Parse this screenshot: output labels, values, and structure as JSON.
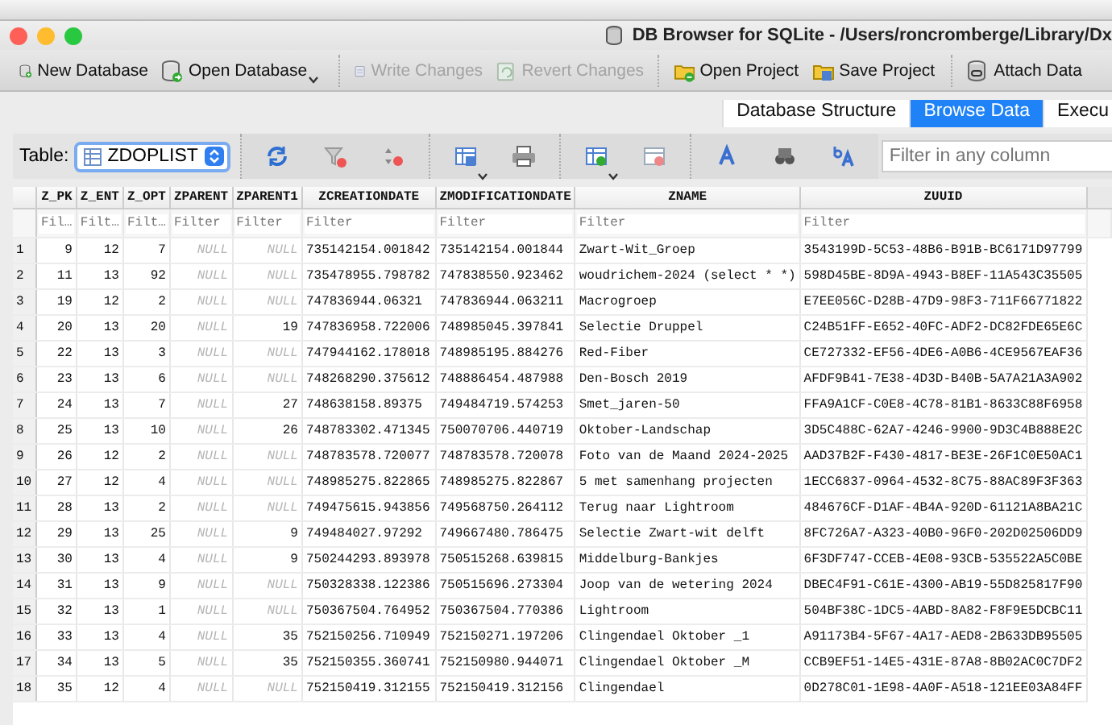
{
  "title_bar": {
    "title": "DB Browser for SQLite - /Users/roncromberge/Library/Dx"
  },
  "toolbar": {
    "buttons": [
      {
        "label": "New Database",
        "disabled": false
      },
      {
        "label": "Open Database",
        "disabled": false
      },
      {
        "label": "Write Changes",
        "disabled": true
      },
      {
        "label": "Revert Changes",
        "disabled": true
      },
      {
        "label": "Open Project",
        "disabled": false
      },
      {
        "label": "Save Project",
        "disabled": false
      },
      {
        "label": "Attach Data",
        "disabled": false
      }
    ]
  },
  "tabs": [
    {
      "label": "Database Structure",
      "selected": false
    },
    {
      "label": "Browse Data",
      "selected": true
    },
    {
      "label": "Execu",
      "selected": false
    }
  ],
  "browse_bar": {
    "table_label": "Table:",
    "table_value": "ZDOPLIST",
    "filter": {
      "placeholder": "Filter in any column"
    }
  },
  "grid": {
    "columns": [
      {
        "name": "Z_PK",
        "placeholder": "Fil…",
        "kind": "number"
      },
      {
        "name": "Z_ENT",
        "placeholder": "Filt…",
        "kind": "number"
      },
      {
        "name": "Z_OPT",
        "placeholder": "Filt…",
        "kind": "number"
      },
      {
        "name": "ZPARENT",
        "placeholder": "Filter",
        "kind": "number"
      },
      {
        "name": "ZPARENT1",
        "placeholder": "Filter",
        "kind": "number"
      },
      {
        "name": "ZCREATIONDATE",
        "placeholder": "Filter",
        "kind": "text"
      },
      {
        "name": "ZMODIFICATIONDATE",
        "placeholder": "Filter",
        "kind": "text"
      },
      {
        "name": "ZNAME",
        "placeholder": "Filter",
        "kind": "text"
      },
      {
        "name": "ZUUID",
        "placeholder": "Filter",
        "kind": "text"
      }
    ],
    "rows": [
      {
        "number": "1",
        "cells": [
          "9",
          "12",
          "7",
          {
            "value": "NULL",
            "is_null": true
          },
          {
            "value": "NULL",
            "is_null": true
          },
          "735142154.001842",
          "735142154.001844",
          "Zwart-Wit_Groep",
          "3543199D-5C53-48B6-B91B-BC6171D97799"
        ]
      },
      {
        "number": "2",
        "cells": [
          "11",
          "13",
          "92",
          {
            "value": "NULL",
            "is_null": true
          },
          {
            "value": "NULL",
            "is_null": true
          },
          "735478955.798782",
          "747838550.923462",
          "woudrichem-2024 (select * *)",
          "598D45BE-8D9A-4943-B8EF-11A543C35505"
        ]
      },
      {
        "number": "3",
        "cells": [
          "19",
          "12",
          "2",
          {
            "value": "NULL",
            "is_null": true
          },
          {
            "value": "NULL",
            "is_null": true
          },
          "747836944.06321",
          "747836944.063211",
          "Macrogroep",
          "E7EE056C-D28B-47D9-98F3-711F66771822"
        ]
      },
      {
        "number": "4",
        "cells": [
          "20",
          "13",
          "20",
          {
            "value": "NULL",
            "is_null": true
          },
          "19",
          "747836958.722006",
          "748985045.397841",
          "Selectie Druppel",
          "C24B51FF-E652-40FC-ADF2-DC82FDE65E6C"
        ]
      },
      {
        "number": "5",
        "cells": [
          "22",
          "13",
          "3",
          {
            "value": "NULL",
            "is_null": true
          },
          {
            "value": "NULL",
            "is_null": true
          },
          "747944162.178018",
          "748985195.884276",
          "Red-Fiber",
          "CE727332-EF56-4DE6-A0B6-4CE9567EAF36"
        ]
      },
      {
        "number": "6",
        "cells": [
          "23",
          "13",
          "6",
          {
            "value": "NULL",
            "is_null": true
          },
          {
            "value": "NULL",
            "is_null": true
          },
          "748268290.375612",
          "748886454.487988",
          "Den-Bosch 2019",
          "AFDF9B41-7E38-4D3D-B40B-5A7A21A3A902"
        ]
      },
      {
        "number": "7",
        "cells": [
          "24",
          "13",
          "7",
          {
            "value": "NULL",
            "is_null": true
          },
          "27",
          "748638158.89375",
          "749484719.574253",
          "Smet_jaren-50",
          "FFA9A1CF-C0E8-4C78-81B1-8633C88F6958"
        ]
      },
      {
        "number": "8",
        "cells": [
          "25",
          "13",
          "10",
          {
            "value": "NULL",
            "is_null": true
          },
          "26",
          "748783302.471345",
          "750070706.440719",
          "Oktober-Landschap",
          "3D5C488C-62A7-4246-9900-9D3C4B888E2C"
        ]
      },
      {
        "number": "9",
        "cells": [
          "26",
          "12",
          "2",
          {
            "value": "NULL",
            "is_null": true
          },
          {
            "value": "NULL",
            "is_null": true
          },
          "748783578.720077",
          "748783578.720078",
          "Foto van de Maand 2024-2025",
          "AAD37B2F-F430-4817-BE3E-26F1C0E50AC1"
        ]
      },
      {
        "number": "10",
        "cells": [
          "27",
          "12",
          "4",
          {
            "value": "NULL",
            "is_null": true
          },
          {
            "value": "NULL",
            "is_null": true
          },
          "748985275.822865",
          "748985275.822867",
          "5 met samenhang projecten",
          "1ECC6837-0964-4532-8C75-88AC89F3F363"
        ]
      },
      {
        "number": "11",
        "cells": [
          "28",
          "13",
          "2",
          {
            "value": "NULL",
            "is_null": true
          },
          {
            "value": "NULL",
            "is_null": true
          },
          "749475615.943856",
          "749568750.264112",
          "Terug naar Lightroom",
          "484676CF-D1AF-4B4A-920D-61121A8BA21C"
        ]
      },
      {
        "number": "12",
        "cells": [
          "29",
          "13",
          "25",
          {
            "value": "NULL",
            "is_null": true
          },
          "9",
          "749484027.97292",
          "749667480.786475",
          "Selectie Zwart-wit delft",
          "8FC726A7-A323-40B0-96F0-202D02506DD9"
        ]
      },
      {
        "number": "13",
        "cells": [
          "30",
          "13",
          "4",
          {
            "value": "NULL",
            "is_null": true
          },
          "9",
          "750244293.893978",
          "750515268.639815",
          "Middelburg-Bankjes",
          "6F3DF747-CCEB-4E08-93CB-535522A5C0BE"
        ]
      },
      {
        "number": "14",
        "cells": [
          "31",
          "13",
          "9",
          {
            "value": "NULL",
            "is_null": true
          },
          {
            "value": "NULL",
            "is_null": true
          },
          "750328338.122386",
          "750515696.273304",
          "Joop van de wetering 2024",
          "DBEC4F91-C61E-4300-AB19-55D825817F90"
        ]
      },
      {
        "number": "15",
        "cells": [
          "32",
          "13",
          "1",
          {
            "value": "NULL",
            "is_null": true
          },
          {
            "value": "NULL",
            "is_null": true
          },
          "750367504.764952",
          "750367504.770386",
          "Lightroom",
          "504BF38C-1DC5-4ABD-8A82-F8F9E5DCBC11"
        ]
      },
      {
        "number": "16",
        "cells": [
          "33",
          "13",
          "4",
          {
            "value": "NULL",
            "is_null": true
          },
          "35",
          "752150256.710949",
          "752150271.197206",
          "Clingendael Oktober _1",
          "A91173B4-5F67-4A17-AED8-2B633DB95505"
        ]
      },
      {
        "number": "17",
        "cells": [
          "34",
          "13",
          "5",
          {
            "value": "NULL",
            "is_null": true
          },
          "35",
          "752150355.360741",
          "752150980.944071",
          "Clingendael Oktober _M",
          "CCB9EF51-14E5-431E-87A8-8B02AC0C7DF2"
        ]
      },
      {
        "number": "18",
        "cells": [
          "35",
          "12",
          "4",
          {
            "value": "NULL",
            "is_null": true
          },
          {
            "value": "NULL",
            "is_null": true
          },
          "752150419.312155",
          "752150419.312156",
          "Clingendael",
          "0D278C01-1E98-4A0F-A518-121EE03A84FF"
        ]
      }
    ]
  }
}
